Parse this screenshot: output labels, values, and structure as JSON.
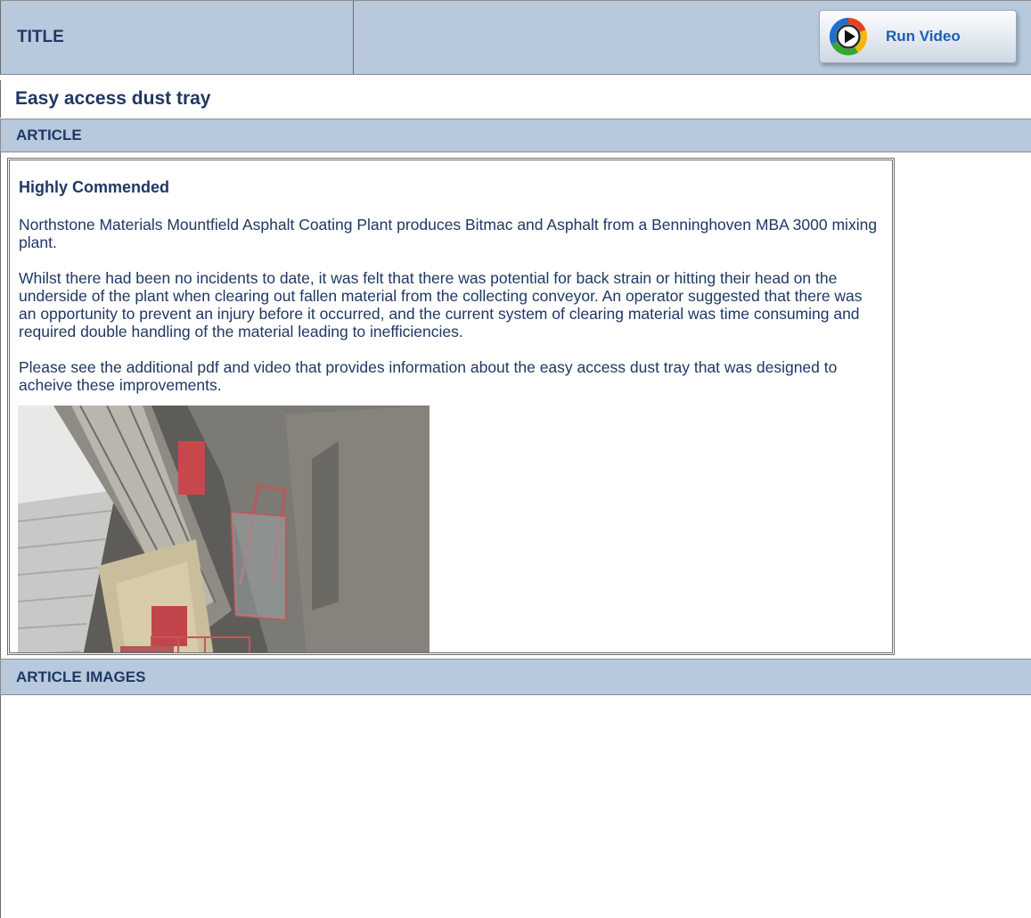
{
  "header": {
    "title_label": "TITLE",
    "run_video_label": "Run Video"
  },
  "article_title": "Easy access dust tray",
  "sections": {
    "article": "ARTICLE",
    "article_images": "ARTICLE IMAGES"
  },
  "article": {
    "heading": "Highly Commended",
    "paragraphs": [
      "Northstone Materials Mountfield Asphalt Coating Plant produces Bitmac and Asphalt from a Benninghoven MBA 3000 mixing plant.",
      "Whilst there had been no incidents to date, it was felt that there was potential for back strain or hitting their head on the underside of the plant when clearing out fallen material from the collecting conveyor. An operator suggested that there was an opportunity to prevent an injury before it occurred, and the current system of clearing material was time consuming and required double handling of the material leading to inefficiencies.",
      "Please see the additional pdf and video that provides information about the easy access dust tray that was designed to acheive these improvements."
    ]
  },
  "colors": {
    "header_band": "#b8c9dd",
    "text": "#1f3864",
    "button_text": "#1a5fb4"
  },
  "icons": {
    "run_video": "media-player-play-icon"
  }
}
